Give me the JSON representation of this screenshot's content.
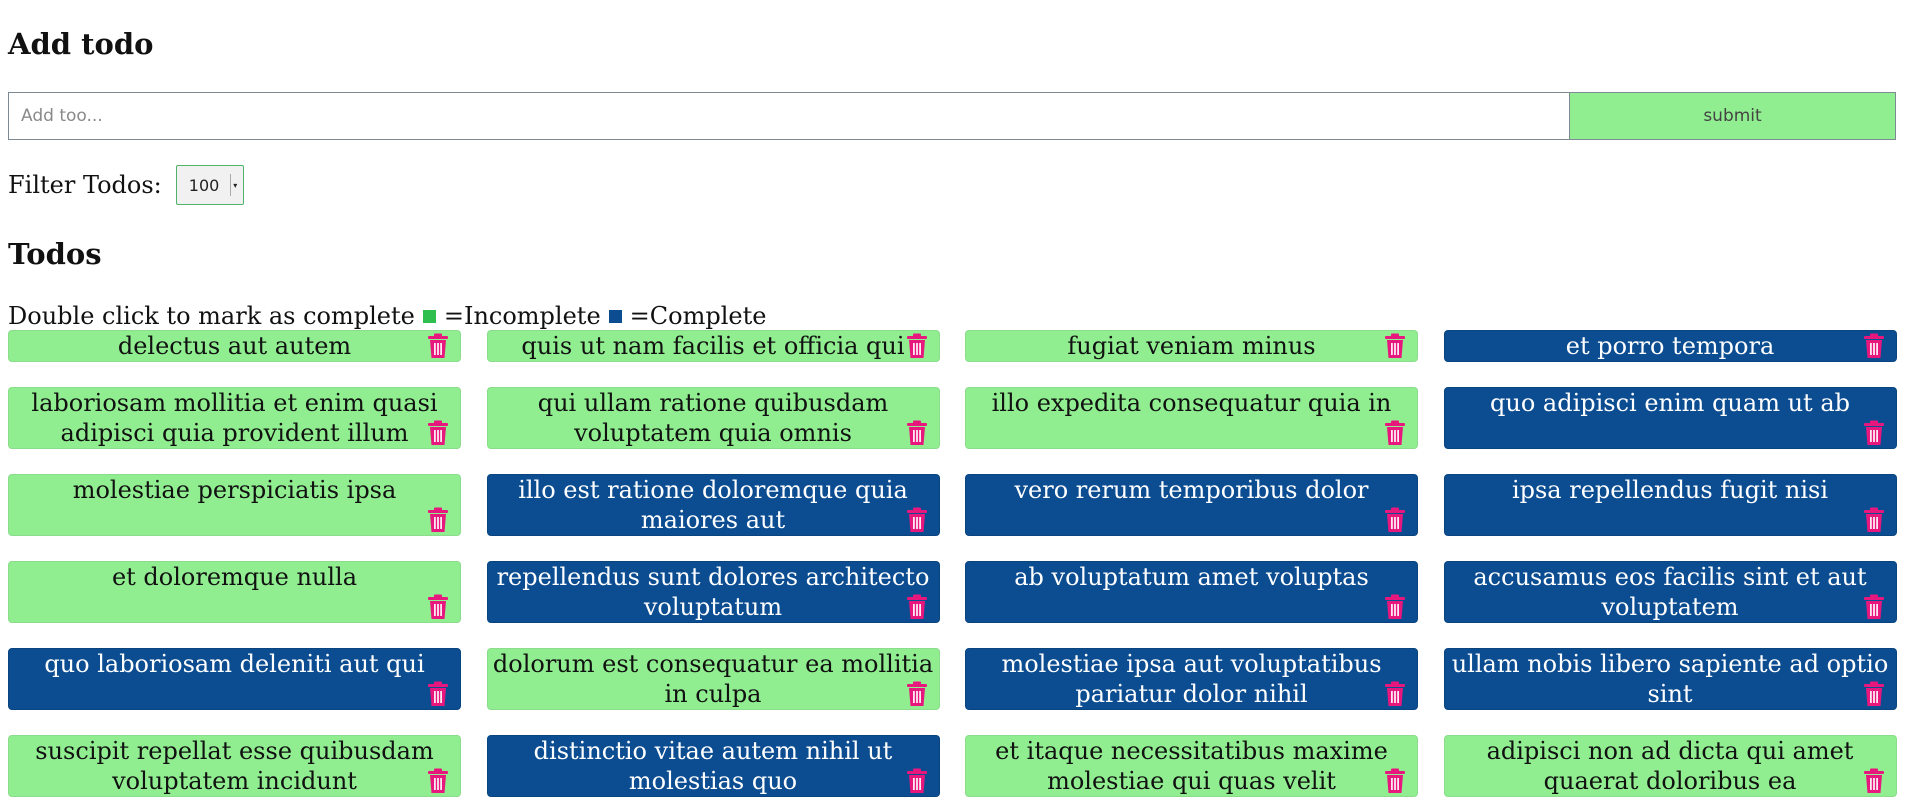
{
  "add_section": {
    "heading": "Add todo",
    "input_placeholder": "Add too...",
    "input_value": "",
    "submit_label": "submit"
  },
  "filter": {
    "label": "Filter Todos:",
    "selected": "100"
  },
  "todos_section": {
    "heading": "Todos",
    "legend_prefix": "Double click to mark as complete",
    "legend_incomplete": "=Incomplete",
    "legend_complete": "=Complete",
    "color_incomplete": "#2fbf4f",
    "color_complete": "#0c4d92"
  },
  "colors": {
    "incomplete_bg": "#90ee90",
    "complete_bg": "#0c4d92",
    "trash_icon": "#e8177e"
  },
  "todos": [
    {
      "title": "delectus aut autem",
      "completed": false
    },
    {
      "title": "quis ut nam facilis et officia qui",
      "completed": false
    },
    {
      "title": "fugiat veniam minus",
      "completed": false
    },
    {
      "title": "et porro tempora",
      "completed": true
    },
    {
      "title": "laboriosam mollitia et enim quasi adipisci quia provident illum",
      "completed": false
    },
    {
      "title": "qui ullam ratione quibusdam voluptatem quia omnis",
      "completed": false
    },
    {
      "title": "illo expedita consequatur quia in",
      "completed": false
    },
    {
      "title": "quo adipisci enim quam ut ab",
      "completed": true
    },
    {
      "title": "molestiae perspiciatis ipsa",
      "completed": false
    },
    {
      "title": "illo est ratione doloremque quia maiores aut",
      "completed": true
    },
    {
      "title": "vero rerum temporibus dolor",
      "completed": true
    },
    {
      "title": "ipsa repellendus fugit nisi",
      "completed": true
    },
    {
      "title": "et doloremque nulla",
      "completed": false
    },
    {
      "title": "repellendus sunt dolores architecto voluptatum",
      "completed": true
    },
    {
      "title": "ab voluptatum amet voluptas",
      "completed": true
    },
    {
      "title": "accusamus eos facilis sint et aut voluptatem",
      "completed": true
    },
    {
      "title": "quo laboriosam deleniti aut qui",
      "completed": true
    },
    {
      "title": "dolorum est consequatur ea mollitia in culpa",
      "completed": false
    },
    {
      "title": "molestiae ipsa aut voluptatibus pariatur dolor nihil",
      "completed": true
    },
    {
      "title": "ullam nobis libero sapiente ad optio sint",
      "completed": true
    },
    {
      "title": "suscipit repellat esse quibusdam voluptatem incidunt",
      "completed": false
    },
    {
      "title": "distinctio vitae autem nihil ut molestias quo",
      "completed": true
    },
    {
      "title": "et itaque necessitatibus maxime molestiae qui quas velit",
      "completed": false
    },
    {
      "title": "adipisci non ad dicta qui amet quaerat doloribus ea",
      "completed": false
    }
  ]
}
